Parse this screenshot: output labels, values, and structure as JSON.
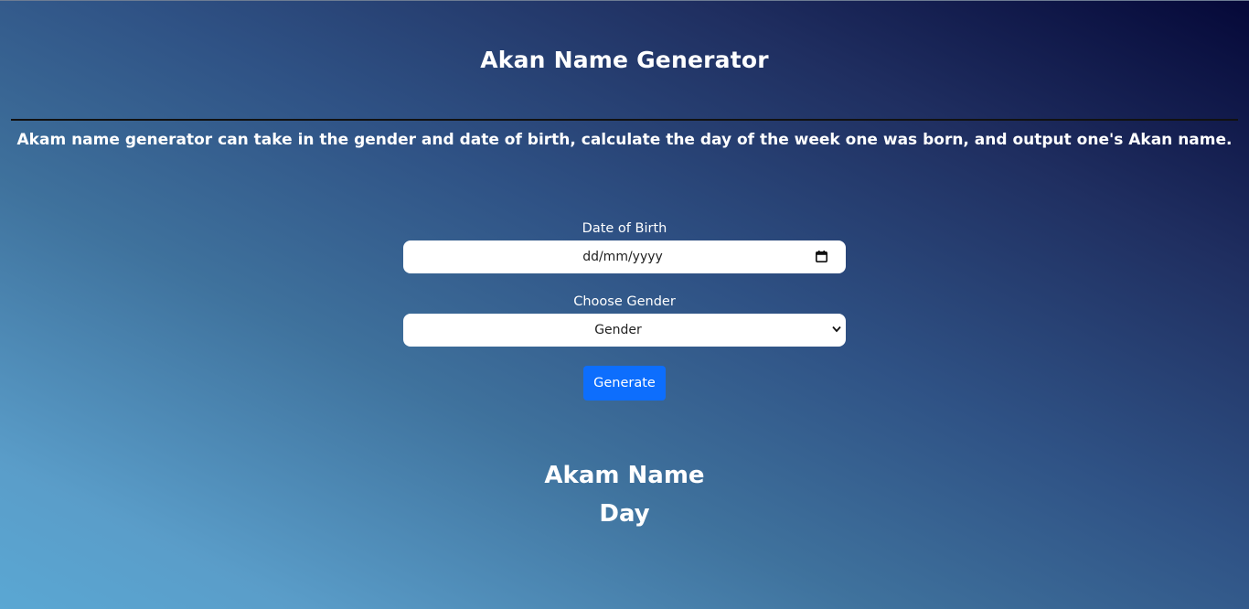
{
  "header": {
    "title": "Akan Name Generator",
    "description": "Akam name generator can take in the gender and date of birth, calculate the day of the week one was born, and output one's Akan name."
  },
  "form": {
    "dob_label": "Date of Birth",
    "dob_placeholder": "dd/mm/yyyy",
    "gender_label": "Choose Gender",
    "gender_selected": "Gender",
    "generate_label": "Generate"
  },
  "result": {
    "name_heading": "Akam Name",
    "day_heading": "Day"
  },
  "icons": {
    "dob_icon": "calendar-icon",
    "gender_icon": "chevron-down-icon"
  },
  "colors": {
    "button_bg": "#0d6efd",
    "text": "#ffffff",
    "divider": "#111111"
  }
}
